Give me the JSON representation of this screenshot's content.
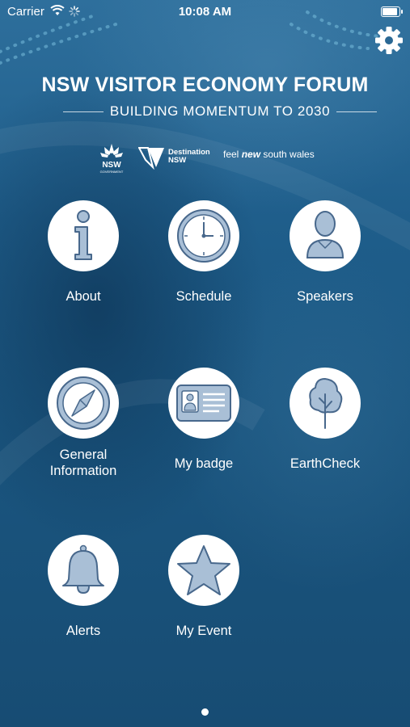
{
  "status_bar": {
    "carrier": "Carrier",
    "time": "10:08 AM"
  },
  "header": {
    "title": "NSW VISITOR ECONOMY FORUM",
    "subtitle": "BUILDING MOMENTUM TO 2030"
  },
  "logos": {
    "nsw_word": "NSW",
    "nsw_small": "GOVERNMENT",
    "destination_line1": "Destination",
    "destination_line2": "NSW",
    "feel_prefix": "feel ",
    "feel_new": "new",
    "feel_suffix": " south wales"
  },
  "menu": {
    "items": [
      {
        "label": "About",
        "icon": "info-icon"
      },
      {
        "label": "Schedule",
        "icon": "clock-icon"
      },
      {
        "label": "Speakers",
        "icon": "person-icon"
      },
      {
        "label": "General Information",
        "icon": "compass-icon"
      },
      {
        "label": "My badge",
        "icon": "badge-icon"
      },
      {
        "label": "EarthCheck",
        "icon": "tree-icon"
      },
      {
        "label": "Alerts",
        "icon": "bell-icon"
      },
      {
        "label": "My Event",
        "icon": "star-icon"
      }
    ]
  },
  "pager": {
    "pages": 1,
    "current": 1
  },
  "colors": {
    "icon_fill": "#a9bfd6",
    "icon_stroke": "#48688c",
    "background": "#1c5a86"
  }
}
